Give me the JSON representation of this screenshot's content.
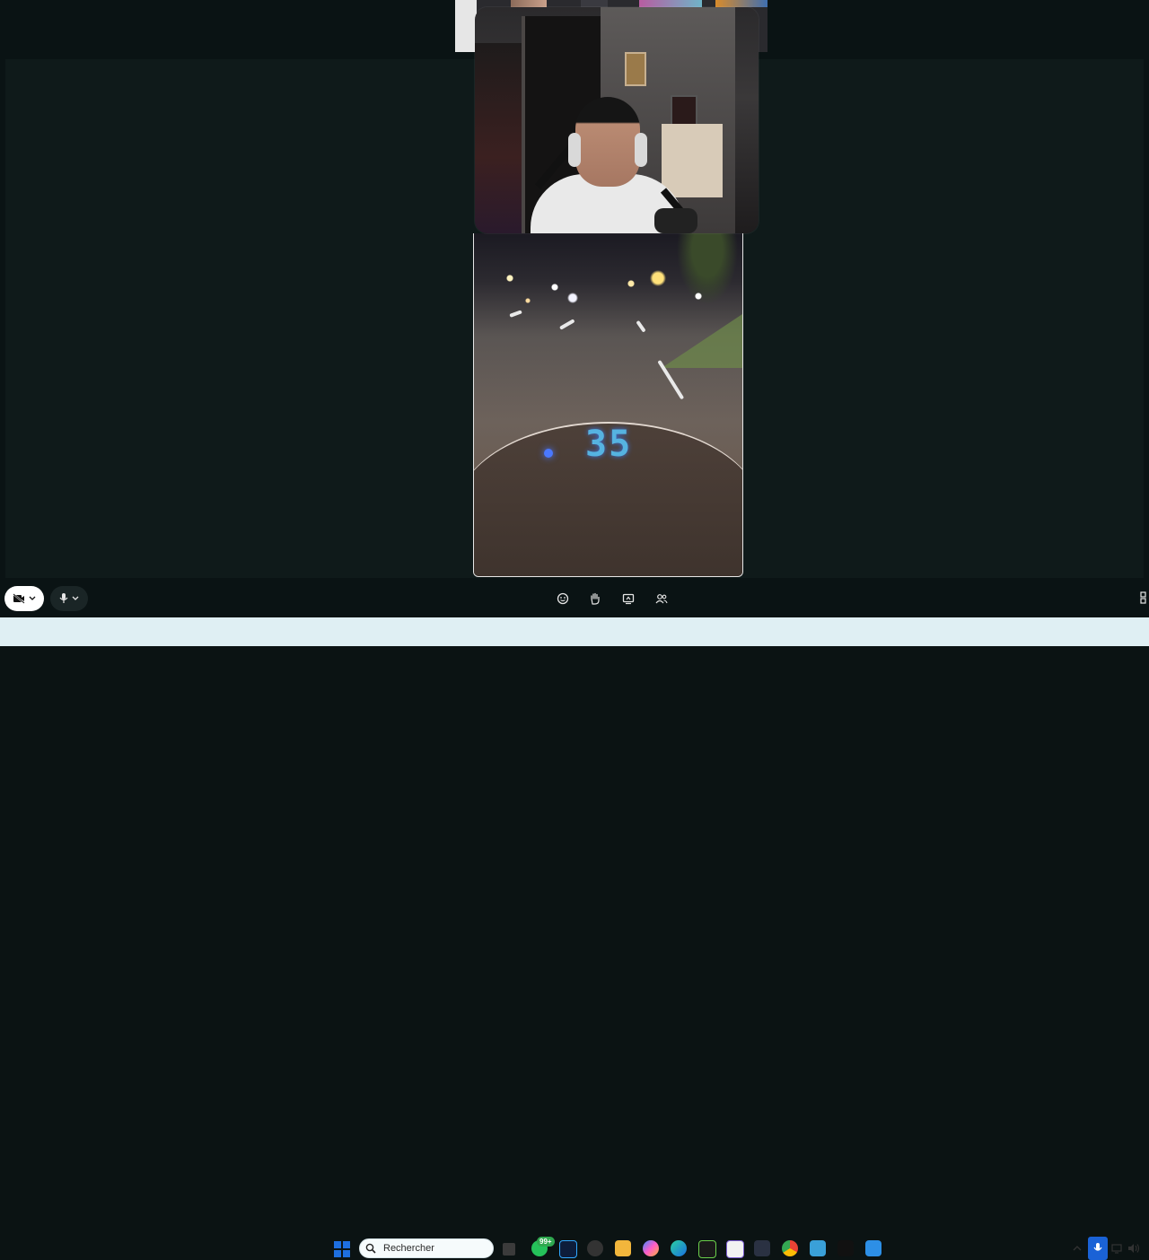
{
  "meeting": {
    "webcam_label": "",
    "toolbar": {
      "camera_icon": "camera-off-icon",
      "camera_menu_icon": "chevron-down-icon",
      "mic_icon": "microphone-icon",
      "mic_menu_icon": "chevron-down-icon",
      "reactions_icon": "smiley-icon",
      "raise_hand_icon": "hand-icon",
      "share_icon": "share-screen-icon",
      "people_icon": "people-icon"
    },
    "video_overlay": {
      "hud_speed": "35"
    }
  },
  "taskbar": {
    "search_placeholder": "Rechercher",
    "whatsapp_badge": "99+",
    "apps": [
      "file-explorer-icon",
      "whatsapp-icon",
      "photoshop-icon",
      "app-icon",
      "folder-icon",
      "copilot-icon",
      "edge-icon",
      "app-icon",
      "app-icon",
      "app-icon",
      "chrome-icon",
      "notepad-icon",
      "app-icon",
      "photos-icon"
    ],
    "tray": [
      "chevron-up-icon",
      "microphone-icon",
      "display-icon",
      "volume-icon"
    ]
  },
  "colors": {
    "background": "#0a1314",
    "taskbar": "#dfeff3",
    "accent": "#1a62d6"
  }
}
